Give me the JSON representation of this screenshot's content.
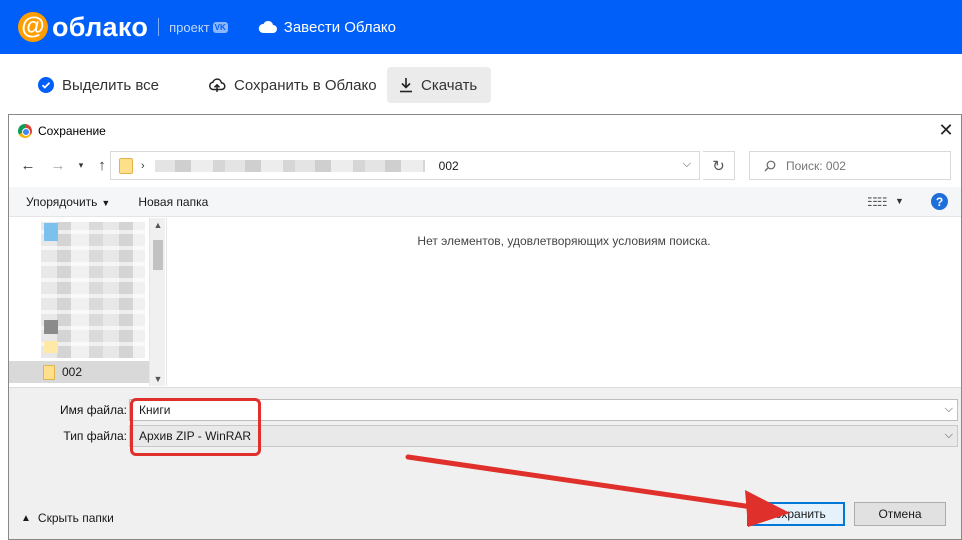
{
  "header": {
    "logo_text": "облако",
    "logo_sub": "проект",
    "vk_badge": "VK",
    "get_cloud": "Завести Облако"
  },
  "toolbar": {
    "select_all": "Выделить все",
    "save_to_cloud": "Сохранить в Облако",
    "download": "Скачать"
  },
  "dialog": {
    "title": "Сохранение",
    "address": {
      "separator": "›",
      "last_folder": "002"
    },
    "search_placeholder": "Поиск: 002",
    "commands": {
      "organize": "Упорядочить",
      "new_folder": "Новая папка"
    },
    "tree": {
      "selected_folder": "002"
    },
    "empty_message": "Нет элементов, удовлетворяющих условиям поиска.",
    "filename_label": "Имя файла:",
    "filename_value": "Книги",
    "filetype_label": "Тип файла:",
    "filetype_value": "Архив ZIP - WinRAR",
    "hide_folders": "Скрыть папки",
    "save_button": "Сохранить",
    "cancel_button": "Отмена"
  },
  "colors": {
    "header_bg": "#005ff9",
    "logo_accent": "#ff9e00",
    "annotation": "#e0302b",
    "primary_button_border": "#0078d7"
  }
}
